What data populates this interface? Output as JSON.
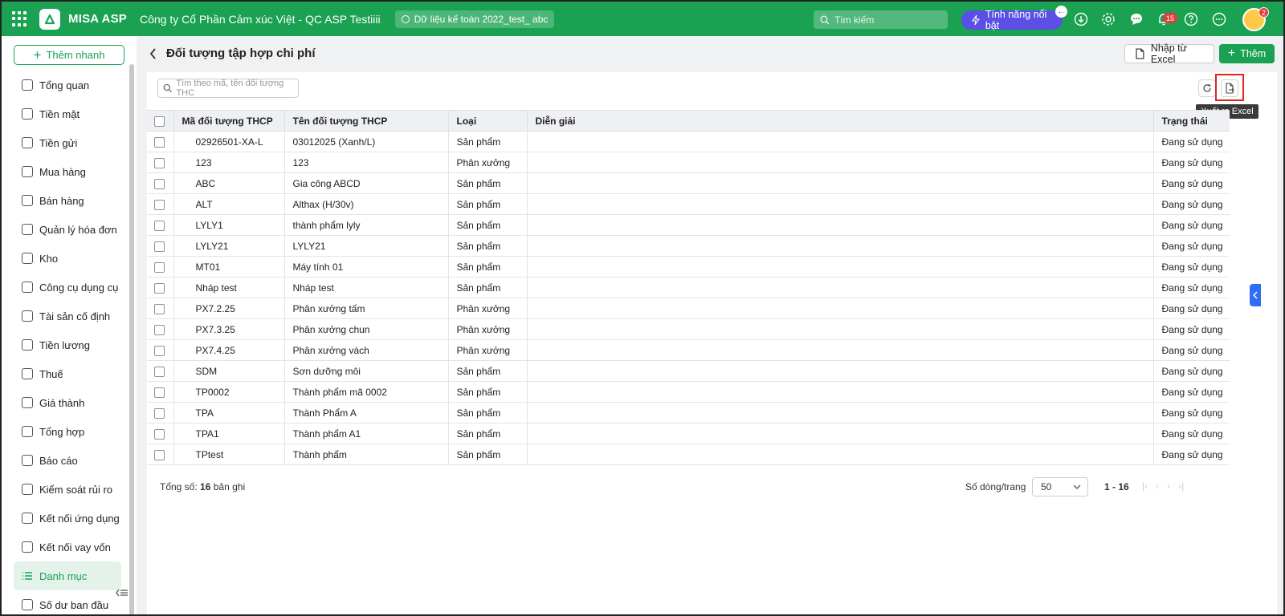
{
  "topbar": {
    "brand": "MISA ASP",
    "company": "Công ty Cổ Phần Cảm xúc Việt - QC ASP Testiiii",
    "dataset": "Dữ liệu kế toán 2022_test_ abc",
    "search_placeholder": "Tìm kiếm",
    "feature_label": "Tính năng nổi bật",
    "notification_count": "15",
    "avatar_badge": "2",
    "brand_color": "#1aa152"
  },
  "sidebar": {
    "quick_add": "Thêm nhanh",
    "items": [
      {
        "label": "Tổng quan",
        "icon": "dashboard-icon"
      },
      {
        "label": "Tiền mặt",
        "icon": "cash-icon"
      },
      {
        "label": "Tiền gửi",
        "icon": "bank-icon"
      },
      {
        "label": "Mua hàng",
        "icon": "shopping-bag-icon"
      },
      {
        "label": "Bán hàng",
        "icon": "cart-icon"
      },
      {
        "label": "Quản lý hóa đơn",
        "icon": "invoice-icon"
      },
      {
        "label": "Kho",
        "icon": "warehouse-icon"
      },
      {
        "label": "Công cụ dụng cụ",
        "icon": "tools-icon"
      },
      {
        "label": "Tài sản cố định",
        "icon": "truck-icon"
      },
      {
        "label": "Tiền lương",
        "icon": "salary-icon"
      },
      {
        "label": "Thuế",
        "icon": "tax-icon"
      },
      {
        "label": "Giá thành",
        "icon": "cost-icon"
      },
      {
        "label": "Tổng hợp",
        "icon": "summary-icon"
      },
      {
        "label": "Báo cáo",
        "icon": "report-icon"
      },
      {
        "label": "Kiểm soát rủi ro",
        "icon": "risk-icon"
      },
      {
        "label": "Kết nối ứng dụng",
        "icon": "plug-icon"
      },
      {
        "label": "Kết nối vay vốn",
        "icon": "loan-icon"
      },
      {
        "label": "Danh mục",
        "icon": "list-icon",
        "active": true
      },
      {
        "label": "Số dư ban đầu",
        "icon": "balance-icon"
      }
    ]
  },
  "page": {
    "title": "Đối tượng tập hợp chi phí",
    "import_label": "Nhập từ Excel",
    "add_label": "Thêm",
    "search_placeholder": "Tìm theo mã, tên đối tượng THC",
    "export_tooltip": "Xuất ra Excel"
  },
  "table": {
    "columns": [
      "Mã đối tượng THCP",
      "Tên đối tượng THCP",
      "Loại",
      "Diễn giải",
      "Trạng thái"
    ],
    "rows": [
      [
        "02926501-XA-L",
        "03012025 (Xanh/L)",
        "Sản phẩm",
        "",
        "Đang sử dụng"
      ],
      [
        "123",
        "123",
        "Phân xưởng",
        "",
        "Đang sử dụng"
      ],
      [
        "ABC",
        "Gia công ABCD",
        "Sản phẩm",
        "",
        "Đang sử dụng"
      ],
      [
        "ALT",
        "Althax (H/30v)",
        "Sản phẩm",
        "",
        "Đang sử dụng"
      ],
      [
        "LYLY1",
        "thành phẩm lyly",
        "Sản phẩm",
        "",
        "Đang sử dụng"
      ],
      [
        "LYLY21",
        "LYLY21",
        "Sản phẩm",
        "",
        "Đang sử dụng"
      ],
      [
        "MT01",
        "Máy tính 01",
        "Sản phẩm",
        "",
        "Đang sử dụng"
      ],
      [
        "Nháp test",
        "Nháp test",
        "Sản phẩm",
        "",
        "Đang sử dụng"
      ],
      [
        "PX7.2.25",
        "Phân xưởng tấm",
        "Phân xưởng",
        "",
        "Đang sử dụng"
      ],
      [
        "PX7.3.25",
        "Phân xưởng chun",
        "Phân xưởng",
        "",
        "Đang sử dụng"
      ],
      [
        "PX7.4.25",
        "Phân xưởng vách",
        "Phân xưởng",
        "",
        "Đang sử dụng"
      ],
      [
        "SDM",
        "Sơn dưỡng môi",
        "Sản phẩm",
        "",
        "Đang sử dụng"
      ],
      [
        "TP0002",
        "Thành phẩm mã 0002",
        "Sản phẩm",
        "",
        "Đang sử dụng"
      ],
      [
        "TPA",
        "Thành Phẩm A",
        "Sản phẩm",
        "",
        "Đang sử dụng"
      ],
      [
        "TPA1",
        "Thành phẩm A1",
        "Sản phẩm",
        "",
        "Đang sử dụng"
      ],
      [
        "TPtest",
        "Thành phẩm",
        "Sản phẩm",
        "",
        "Đang sử dụng"
      ]
    ]
  },
  "footer": {
    "total_prefix": "Tổng số:",
    "total_count": "16",
    "total_suffix": "bản ghi",
    "page_size_label": "Số dòng/trang",
    "page_size": "50",
    "range": "1 - 16"
  }
}
